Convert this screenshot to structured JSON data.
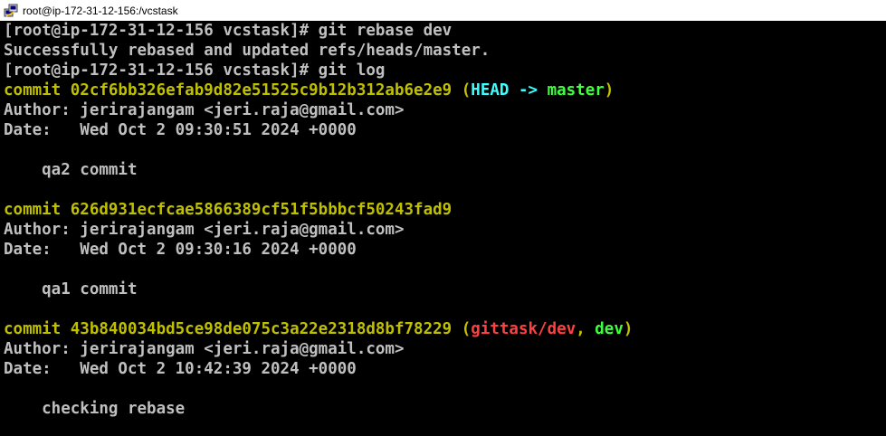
{
  "window": {
    "title": "root@ip-172-31-12-156:/vcstask",
    "icon": "putty-terminal-icon"
  },
  "terminal": {
    "lines": [
      {
        "segments": [
          {
            "text": "[root@ip-172-31-12-156 vcstask]# git rebase dev",
            "color": "#c0c0c0"
          }
        ]
      },
      {
        "segments": [
          {
            "text": "Successfully rebased and updated refs/heads/master.",
            "color": "#c0c0c0"
          }
        ]
      },
      {
        "segments": [
          {
            "text": "[root@ip-172-31-12-156 vcstask]# git log",
            "color": "#c0c0c0"
          }
        ]
      },
      {
        "segments": [
          {
            "text": "commit 02cf6bb326efab9d82e51525c9b12b312ab6e2e9 ",
            "color": "#c0c000"
          },
          {
            "text": "(",
            "color": "#c0c000"
          },
          {
            "text": "HEAD -> ",
            "color": "#40ffff"
          },
          {
            "text": "master",
            "color": "#40ff40"
          },
          {
            "text": ")",
            "color": "#c0c000"
          }
        ]
      },
      {
        "segments": [
          {
            "text": "Author: jerirajangam <jeri.raja@gmail.com>",
            "color": "#c0c0c0"
          }
        ]
      },
      {
        "segments": [
          {
            "text": "Date:   Wed Oct 2 09:30:51 2024 +0000",
            "color": "#c0c0c0"
          }
        ]
      },
      {
        "segments": [
          {
            "text": "",
            "color": "#c0c0c0"
          }
        ]
      },
      {
        "segments": [
          {
            "text": "    qa2 commit",
            "color": "#c0c0c0"
          }
        ]
      },
      {
        "segments": [
          {
            "text": "",
            "color": "#c0c0c0"
          }
        ]
      },
      {
        "segments": [
          {
            "text": "commit 626d931ecfcae5866389cf51f5bbbcf50243fad9",
            "color": "#c0c000"
          }
        ]
      },
      {
        "segments": [
          {
            "text": "Author: jerirajangam <jeri.raja@gmail.com>",
            "color": "#c0c0c0"
          }
        ]
      },
      {
        "segments": [
          {
            "text": "Date:   Wed Oct 2 09:30:16 2024 +0000",
            "color": "#c0c0c0"
          }
        ]
      },
      {
        "segments": [
          {
            "text": "",
            "color": "#c0c0c0"
          }
        ]
      },
      {
        "segments": [
          {
            "text": "    qa1 commit",
            "color": "#c0c0c0"
          }
        ]
      },
      {
        "segments": [
          {
            "text": "",
            "color": "#c0c0c0"
          }
        ]
      },
      {
        "segments": [
          {
            "text": "commit 43b840034bd5ce98de075c3a22e2318d8bf78229 ",
            "color": "#c0c000"
          },
          {
            "text": "(",
            "color": "#c0c000"
          },
          {
            "text": "gittask/dev",
            "color": "#ff4040"
          },
          {
            "text": ", ",
            "color": "#c0c000"
          },
          {
            "text": "dev",
            "color": "#40ff40"
          },
          {
            "text": ")",
            "color": "#c0c000"
          }
        ]
      },
      {
        "segments": [
          {
            "text": "Author: jerirajangam <jeri.raja@gmail.com>",
            "color": "#c0c0c0"
          }
        ]
      },
      {
        "segments": [
          {
            "text": "Date:   Wed Oct 2 10:42:39 2024 +0000",
            "color": "#c0c0c0"
          }
        ]
      },
      {
        "segments": [
          {
            "text": "",
            "color": "#c0c0c0"
          }
        ]
      },
      {
        "segments": [
          {
            "text": "    checking rebase",
            "color": "#c0c0c0"
          }
        ]
      }
    ]
  }
}
